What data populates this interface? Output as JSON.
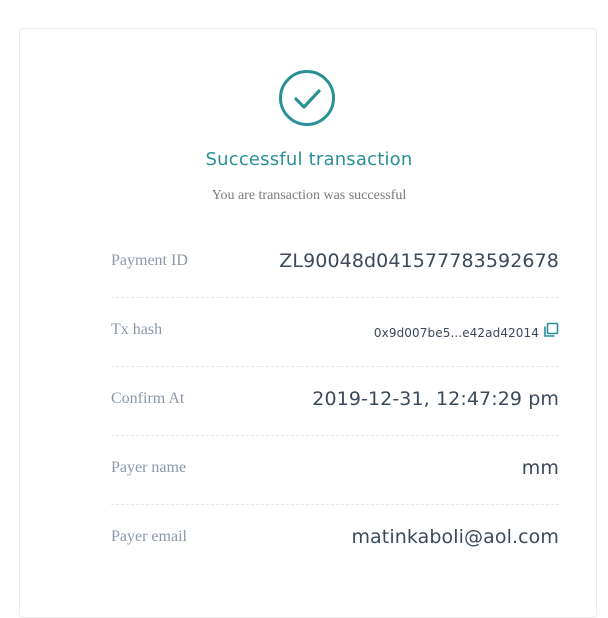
{
  "header": {
    "title": "Successful transaction",
    "subtitle": "You are transaction was successful"
  },
  "icons": {
    "status": "check-circle-icon",
    "copy": "copy-icon"
  },
  "colors": {
    "accent": "#2a9097",
    "label": "#8a98a8",
    "value": "#3b4a5a"
  },
  "details": [
    {
      "label": "Payment ID",
      "value": "ZL90048d041577783592678"
    },
    {
      "label": "Tx hash",
      "value": "0x9d007be5...e42ad42014"
    },
    {
      "label": "Confirm At",
      "value": "2019-12-31, 12:47:29 pm"
    },
    {
      "label": "Payer name",
      "value": "mm"
    },
    {
      "label": "Payer email",
      "value": "matinkaboli@aol.com"
    }
  ]
}
